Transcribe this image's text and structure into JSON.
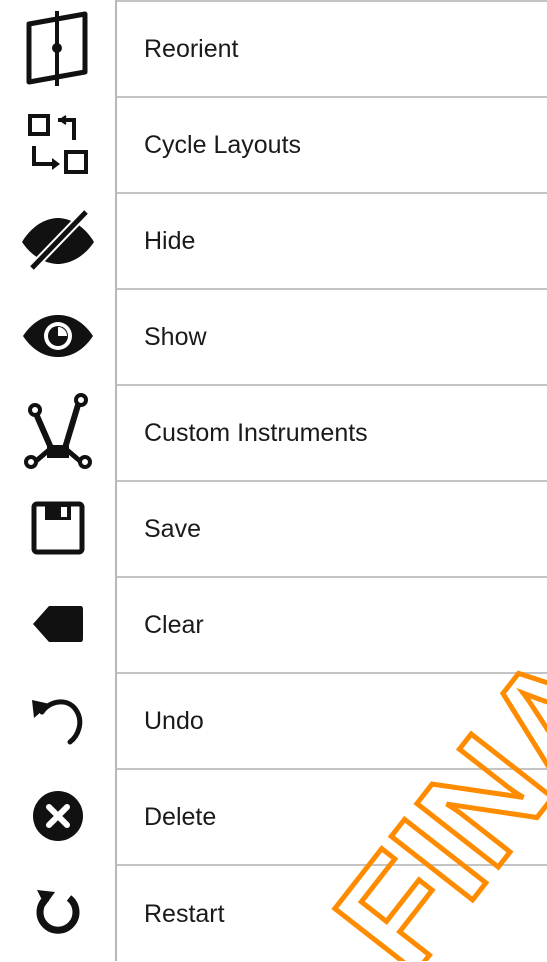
{
  "menu": {
    "items": [
      {
        "label": "Reorient",
        "icon": "reorient-icon"
      },
      {
        "label": "Cycle Layouts",
        "icon": "cycle-layouts-icon"
      },
      {
        "label": "Hide",
        "icon": "eye-slash-icon"
      },
      {
        "label": "Show",
        "icon": "eye-icon"
      },
      {
        "label": "Custom Instruments",
        "icon": "custom-instruments-icon"
      },
      {
        "label": "Save",
        "icon": "floppy-disk-icon"
      },
      {
        "label": "Clear",
        "icon": "clear-icon"
      },
      {
        "label": "Undo",
        "icon": "undo-icon"
      },
      {
        "label": "Delete",
        "icon": "delete-icon"
      },
      {
        "label": "Restart",
        "icon": "restart-icon"
      }
    ]
  },
  "watermark": {
    "text": "FINAL",
    "color": "#ff8c00"
  },
  "colors": {
    "icon": "#111111",
    "text": "#1a1a1a",
    "divider": "#c4c4c4"
  }
}
